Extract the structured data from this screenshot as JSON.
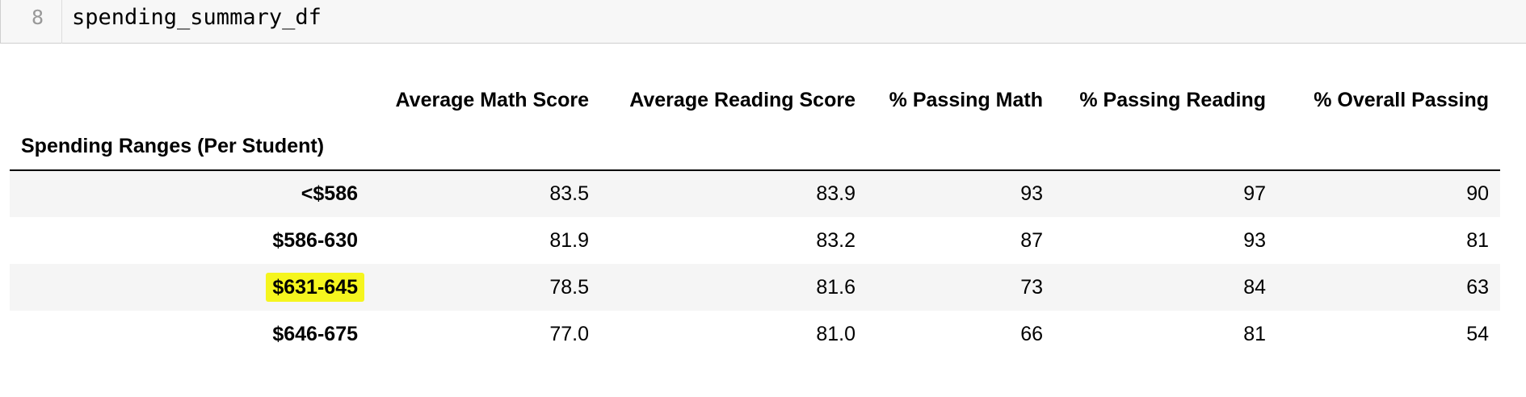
{
  "code_cell": {
    "line_number": "8",
    "code": "spending_summary_df"
  },
  "table": {
    "index_name": "Spending Ranges (Per Student)",
    "columns": [
      "Average Math Score",
      "Average Reading Score",
      "% Passing Math",
      "% Passing Reading",
      "% Overall Passing"
    ],
    "rows": [
      {
        "index": "<$586",
        "values": [
          "83.5",
          "83.9",
          "93",
          "97",
          "90"
        ]
      },
      {
        "index": "$586-630",
        "values": [
          "81.9",
          "83.2",
          "87",
          "93",
          "81"
        ]
      },
      {
        "index": "$631-645",
        "values": [
          "78.5",
          "81.6",
          "73",
          "84",
          "63"
        ]
      },
      {
        "index": "$646-675",
        "values": [
          "77.0",
          "81.0",
          "66",
          "81",
          "54"
        ]
      }
    ]
  },
  "colors": {
    "highlight": "#f5f51e",
    "stripe": "#f5f5f5",
    "code_background": "#f7f7f7"
  }
}
